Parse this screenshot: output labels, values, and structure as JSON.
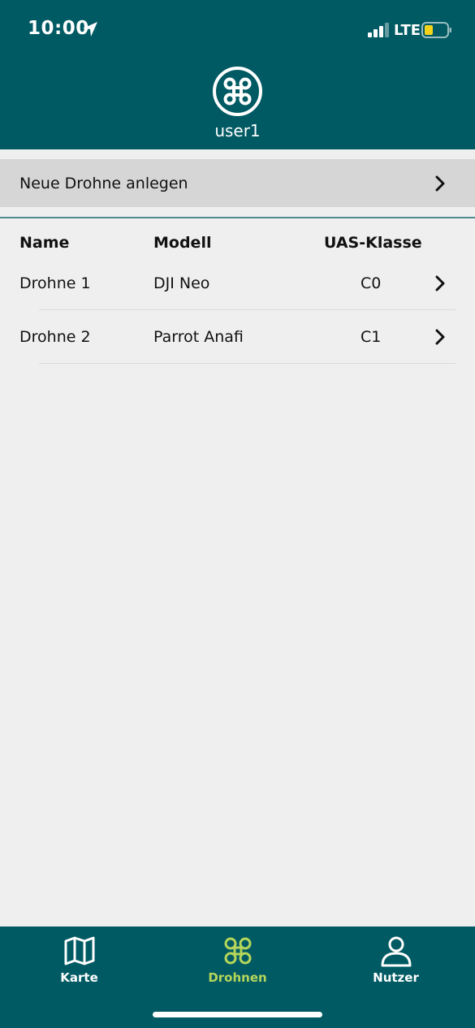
{
  "status_bar": {
    "time": "10:00",
    "network": "LTE"
  },
  "header": {
    "username": "user1"
  },
  "new_drone": {
    "label": "Neue Drohne anlegen"
  },
  "table": {
    "columns": [
      "Name",
      "Modell",
      "UAS-Klasse"
    ],
    "rows": [
      {
        "name": "Drohne 1",
        "model": "DJI Neo",
        "class": "C0"
      },
      {
        "name": "Drohne 2",
        "model": "Parrot Anafi",
        "class": "C1"
      }
    ]
  },
  "tabs": [
    {
      "label": "Karte",
      "icon": "map-icon",
      "active": false
    },
    {
      "label": "Drohnen",
      "icon": "drone-icon",
      "active": true
    },
    {
      "label": "Nutzer",
      "icon": "user-icon",
      "active": false
    }
  ],
  "colors": {
    "primary": "#005a63",
    "accent": "#b5d65a",
    "background": "#efefef",
    "battery": "#f2d21b"
  }
}
